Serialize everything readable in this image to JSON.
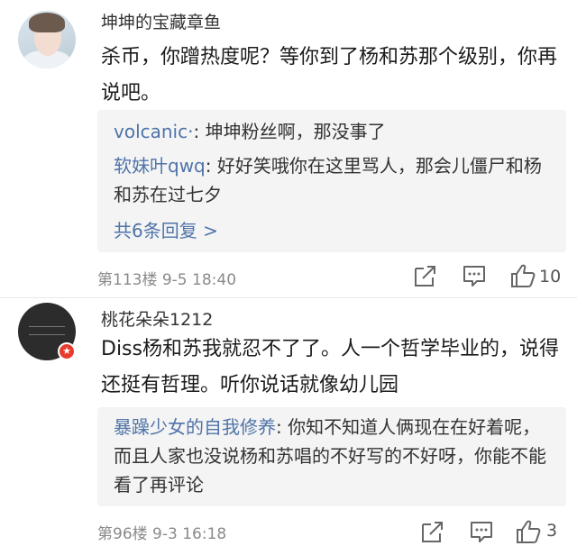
{
  "comments": [
    {
      "username": "坤坤的宝藏章鱼",
      "text": "杀币，你蹭热度呢？等你到了杨和苏那个级别，你再说吧。",
      "replies": [
        {
          "user": "volcanic·",
          "text": "坤坤粉丝啊，那没事了"
        },
        {
          "user": "软妹叶qwq",
          "text": "好好笑哦你在这里骂人，那会儿僵尸和杨和苏在过七夕"
        }
      ],
      "more_replies": "共6条回复 >",
      "floor_time": "第113楼  9-5 18:40",
      "likes": "10"
    },
    {
      "username": "桃花朵朵1212",
      "text": "Diss杨和苏我就忍不了了。人一个哲学毕业的，说得还挺有哲理。听你说话就像幼儿园",
      "badge": "★",
      "replies": [
        {
          "user": "暴躁少女的自我修养",
          "text": "你知不知道人俩现在在好着呢，而且人家也没说杨和苏唱的不好写的不好呀，你能不能看了再评论"
        }
      ],
      "floor_time": "第96楼  9-3 16:18",
      "likes": "3"
    }
  ]
}
